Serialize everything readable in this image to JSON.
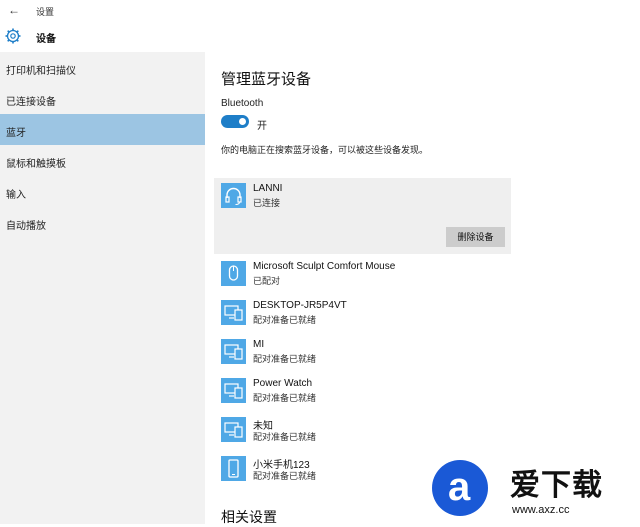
{
  "window": {
    "back_glyph": "←",
    "title": "设置"
  },
  "header": {
    "title": "设备"
  },
  "sidebar": {
    "items": [
      {
        "label": "打印机和扫描仪",
        "active": false
      },
      {
        "label": "已连接设备",
        "active": false
      },
      {
        "label": "蓝牙",
        "active": true
      },
      {
        "label": "鼠标和触摸板",
        "active": false
      },
      {
        "label": "输入",
        "active": false
      },
      {
        "label": "自动播放",
        "active": false
      }
    ]
  },
  "main": {
    "title": "管理蓝牙设备",
    "bluetooth_label": "Bluetooth",
    "toggle_state": "开",
    "status_text": "你的电脑正在搜索蓝牙设备，可以被这些设备发现。",
    "remove_button": "删除设备",
    "related_settings": "相关设置",
    "devices": [
      {
        "name": "LANNI",
        "status": "已连接",
        "icon": "headset-icon"
      },
      {
        "name": "Microsoft Sculpt Comfort Mouse",
        "status": "已配对",
        "icon": "mouse-icon"
      },
      {
        "name": "DESKTOP-JR5P4VT",
        "status": "配对准备已就绪",
        "icon": "computer-icon"
      },
      {
        "name": "MI",
        "status": "配对准备已就绪",
        "icon": "computer-icon"
      },
      {
        "name": "Power Watch",
        "status": "配对准备已就绪",
        "icon": "computer-icon"
      },
      {
        "name": "未知",
        "status": "配对准备已就绪",
        "icon": "computer-icon"
      },
      {
        "name": "小米手机123",
        "status": "配对准备已就绪",
        "icon": "phone-icon"
      }
    ]
  },
  "watermark": {
    "logo_letter": "a",
    "name": "爱下载",
    "url": "www.axz.cc"
  },
  "colors": {
    "accent": "#1e7ec8",
    "active_nav": "#9cc5e3",
    "device_icon_bg": "#4fa8e6",
    "sidebar_bg": "#f2f2f2"
  }
}
